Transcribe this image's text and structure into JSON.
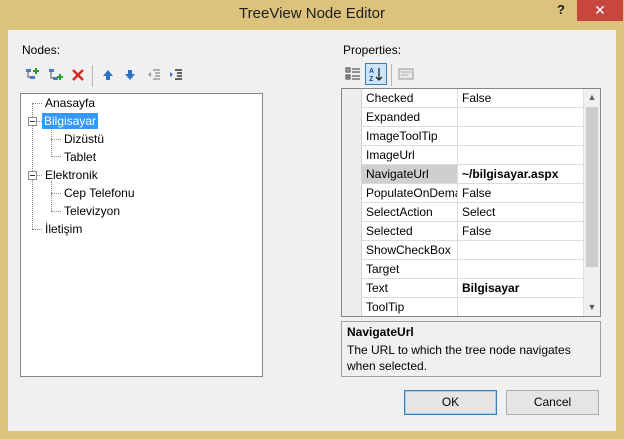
{
  "window": {
    "title": "TreeView Node Editor",
    "help_glyph": "?",
    "close_glyph": "✕"
  },
  "nodes_panel": {
    "label": "Nodes:",
    "toolbar": [
      "add-root-icon",
      "add-child-icon",
      "delete-icon",
      "move-up-icon",
      "move-down-icon",
      "outdent-icon",
      "indent-icon"
    ],
    "tree": [
      {
        "label": "Anasayfa",
        "level": 0
      },
      {
        "label": "Bilgisayar",
        "level": 0,
        "expanded": true,
        "selected": true
      },
      {
        "label": "Dizüstü",
        "level": 1
      },
      {
        "label": "Tablet",
        "level": 1
      },
      {
        "label": "Elektronik",
        "level": 0,
        "expanded": true
      },
      {
        "label": "Cep Telefonu",
        "level": 1
      },
      {
        "label": "Televizyon",
        "level": 1
      },
      {
        "label": "İletişim",
        "level": 0
      }
    ]
  },
  "properties_panel": {
    "label": "Properties:",
    "toolbar": [
      "categorized-icon",
      "alphabetical-icon",
      "property-pages-icon"
    ],
    "rows": [
      {
        "name": "Checked",
        "value": "False"
      },
      {
        "name": "Expanded",
        "value": ""
      },
      {
        "name": "ImageToolTip",
        "value": ""
      },
      {
        "name": "ImageUrl",
        "value": ""
      },
      {
        "name": "NavigateUrl",
        "value": "~/bilgisayar.aspx"
      },
      {
        "name": "PopulateOnDemand",
        "value": "False"
      },
      {
        "name": "SelectAction",
        "value": "Select"
      },
      {
        "name": "Selected",
        "value": "False"
      },
      {
        "name": "ShowCheckBox",
        "value": ""
      },
      {
        "name": "Target",
        "value": ""
      },
      {
        "name": "Text",
        "value": "Bilgisayar"
      },
      {
        "name": "ToolTip",
        "value": ""
      }
    ],
    "description": {
      "title": "NavigateUrl",
      "text": "The URL to which the tree node navigates when selected."
    }
  },
  "buttons": {
    "ok": "OK",
    "cancel": "Cancel"
  }
}
